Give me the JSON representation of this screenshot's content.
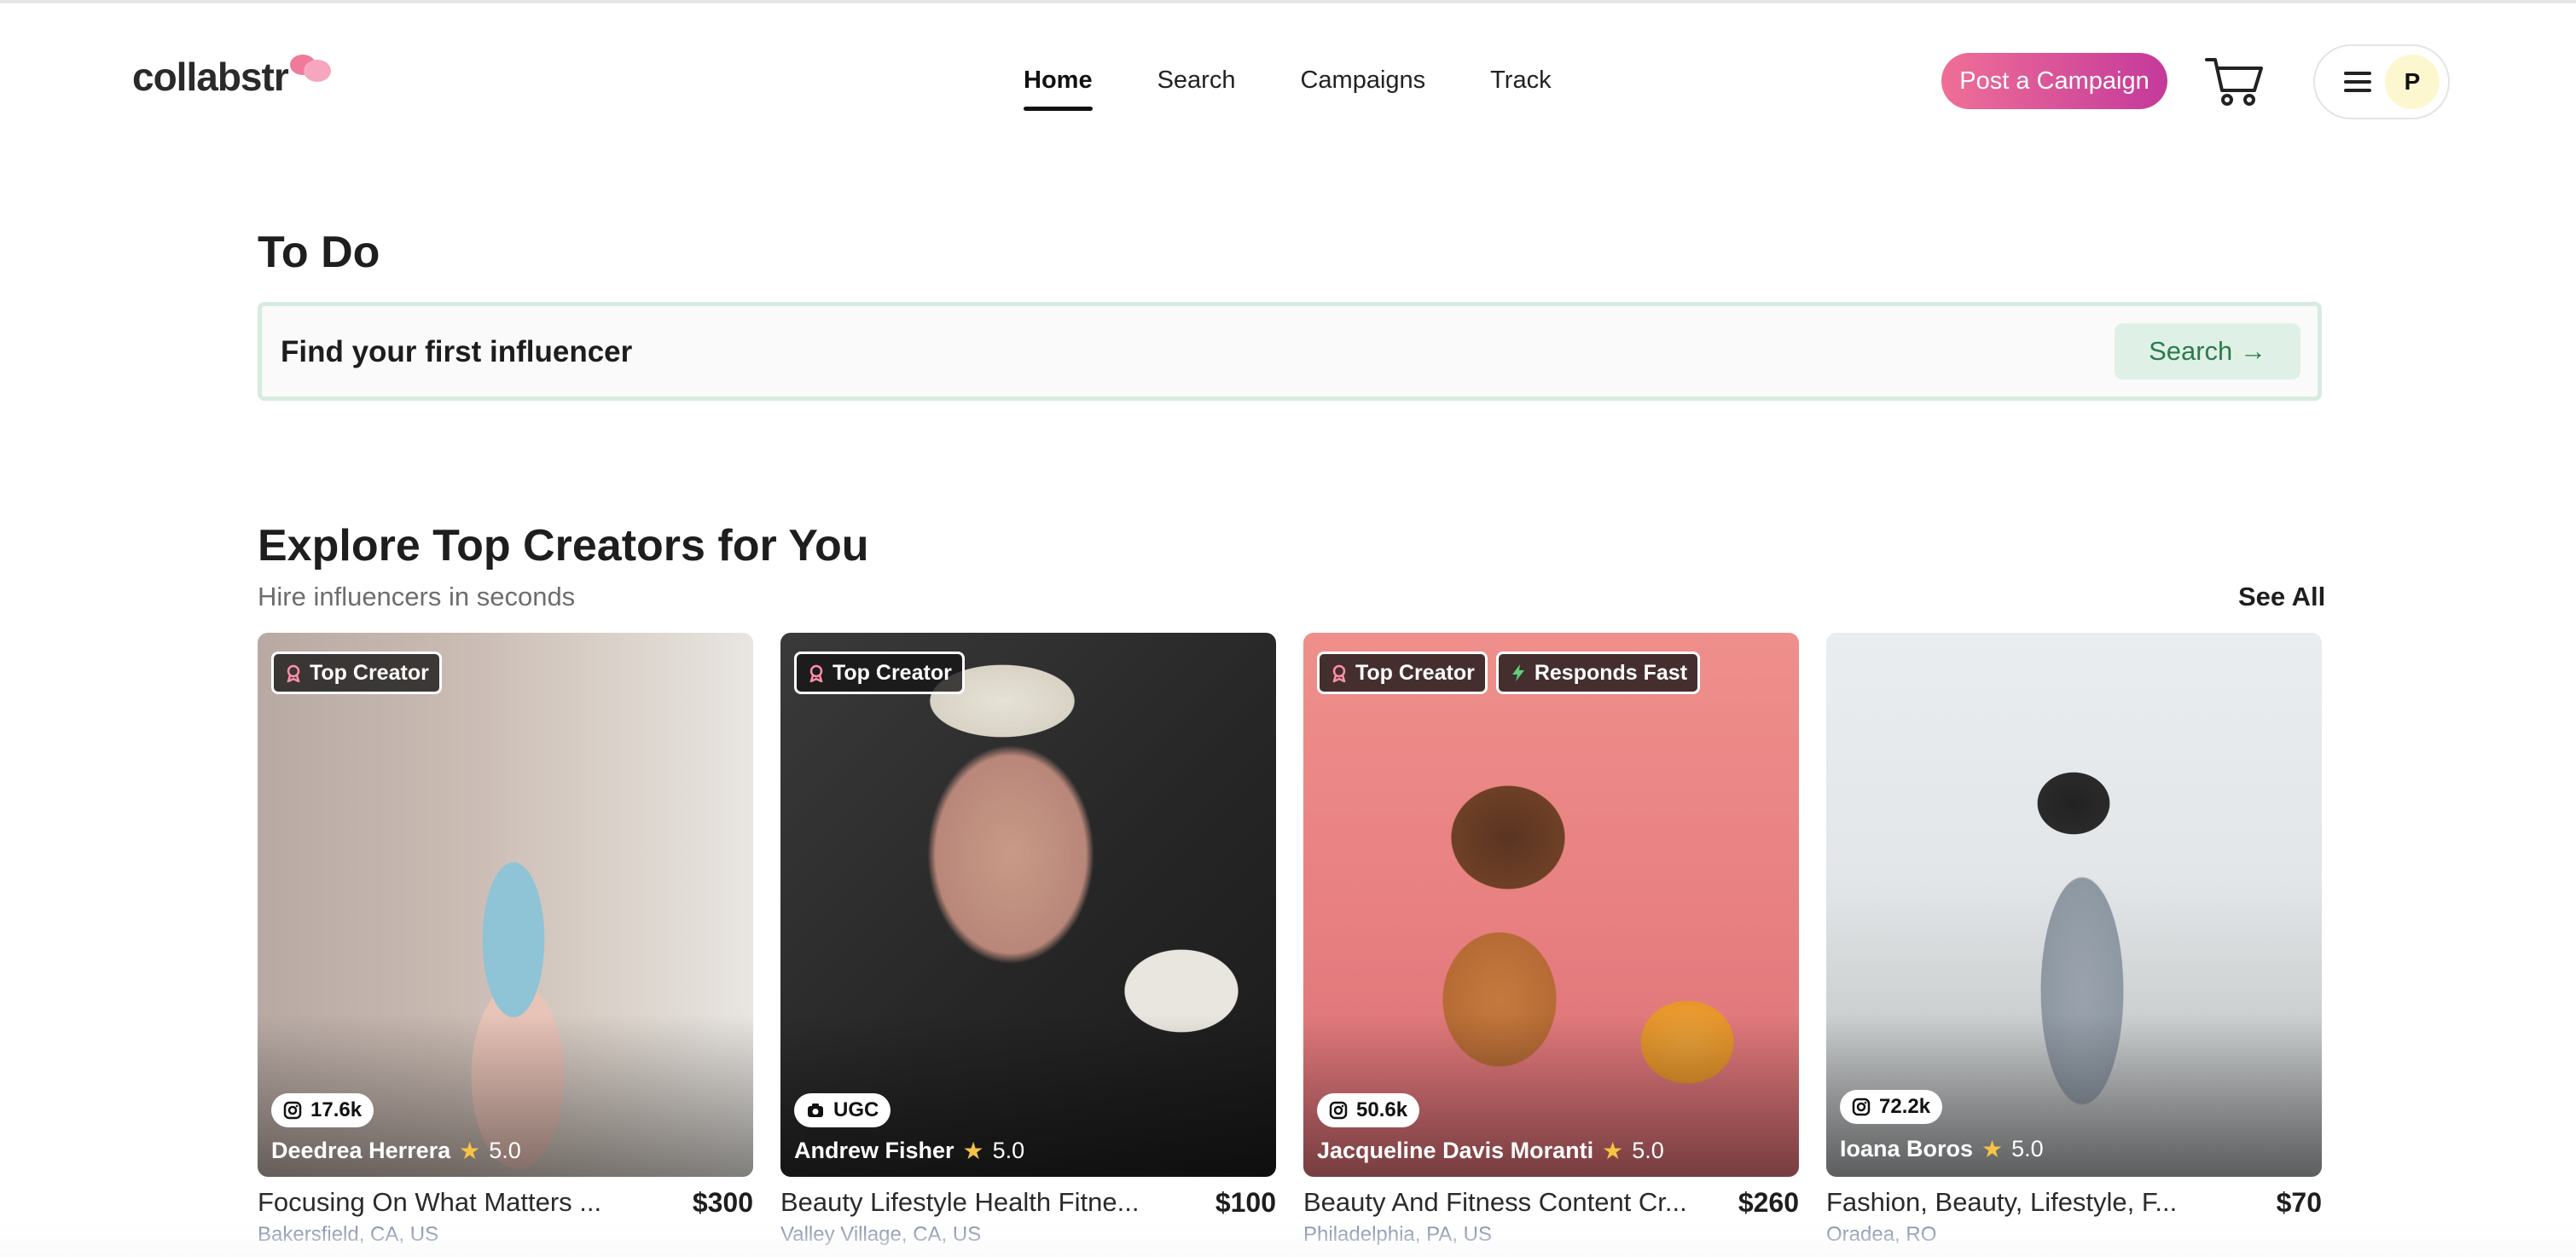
{
  "header": {
    "logo_text": "collabstr",
    "nav": [
      {
        "label": "Home",
        "active": true
      },
      {
        "label": "Search",
        "active": false
      },
      {
        "label": "Campaigns",
        "active": false
      },
      {
        "label": "Track",
        "active": false
      }
    ],
    "post_button": "Post a Campaign",
    "avatar_initial": "P",
    "brand_gradient": [
      "#ef6f97",
      "#c4399a"
    ]
  },
  "todo": {
    "title": "To Do",
    "task": "Find your first influencer",
    "search_button": "Search →"
  },
  "explore": {
    "title": "Explore Top Creators for You",
    "subtitle": "Hire influencers in seconds",
    "see_all": "See All"
  },
  "creators": [
    {
      "badges": [
        "Top Creator"
      ],
      "stat": "17.6k",
      "stat_icon": "instagram-icon",
      "name": "Deedrea Herrera",
      "rating": "5.0",
      "title": "Focusing On What Matters ...",
      "price": "$300",
      "location": "Bakersfield, CA, US"
    },
    {
      "badges": [
        "Top Creator"
      ],
      "stat": "UGC",
      "stat_icon": "camera-icon",
      "name": "Andrew Fisher",
      "rating": "5.0",
      "title": "Beauty Lifestyle Health Fitne...",
      "price": "$100",
      "location": "Valley Village, CA, US"
    },
    {
      "badges": [
        "Top Creator",
        "Responds Fast"
      ],
      "stat": "50.6k",
      "stat_icon": "instagram-icon",
      "name": "Jacqueline Davis Moranti",
      "rating": "5.0",
      "title": "Beauty And Fitness Content Cr...",
      "price": "$260",
      "location": "Philadelphia, PA, US"
    },
    {
      "badges": [],
      "stat": "72.2k",
      "stat_icon": "instagram-icon",
      "name": "Ioana Boros",
      "rating": "5.0",
      "title": "Fashion, Beauty, Lifestyle, F...",
      "price": "$70",
      "location": "Oradea, RO"
    }
  ]
}
